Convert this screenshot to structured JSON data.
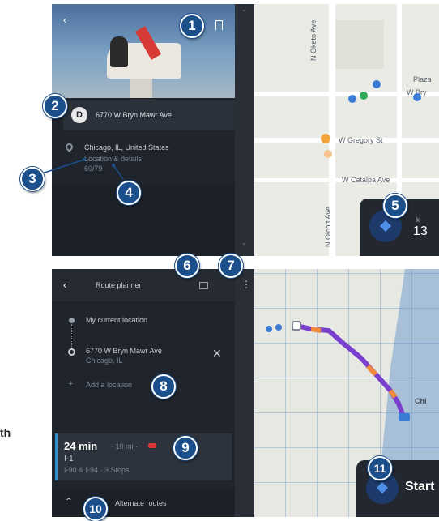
{
  "top_screen": {
    "place_address": "6770 W Bryn Mawr Ave",
    "place_city": "Chicago, IL, United States",
    "place_detail_line1": "Location & details",
    "place_detail_line2": "60/79",
    "map_labels": {
      "street_vertical_1": "N Oketo Ave",
      "street_vertical_2": "N Olcott Ave",
      "street_gregory": "W Gregory St",
      "street_catalpa": "W Catalpa Ave",
      "street_bryn_mawr": "W Bry",
      "place_poi": "Plaza"
    },
    "speed_value": "13",
    "speed_unit": "k"
  },
  "bottom_screen": {
    "title": "Route planner",
    "origin": "My current location",
    "destination_line1": "6770 W Bryn Mawr Ave",
    "destination_line2": "Chicago, IL",
    "add_location": "Add a location",
    "route_time": "24 min",
    "route_distance": "· 10 mi ·",
    "route_road": "I-1",
    "route_via": "I-90 & I-94 · 3 Stops",
    "alternate_routes": "Alternate routes",
    "start_label": "Start",
    "map_city_label": "Chi"
  },
  "side_label": "th",
  "callouts": [
    "1",
    "2",
    "3",
    "4",
    "5",
    "6",
    "7",
    "8",
    "9",
    "10",
    "11"
  ],
  "colors": {
    "panel": "#20252d",
    "map_land": "#e9ebe4",
    "lake": "#a7c0d7",
    "route_purple": "#7a3fcf",
    "route_orange": "#f08a3c",
    "callout_blue": "#1b4f8c"
  }
}
